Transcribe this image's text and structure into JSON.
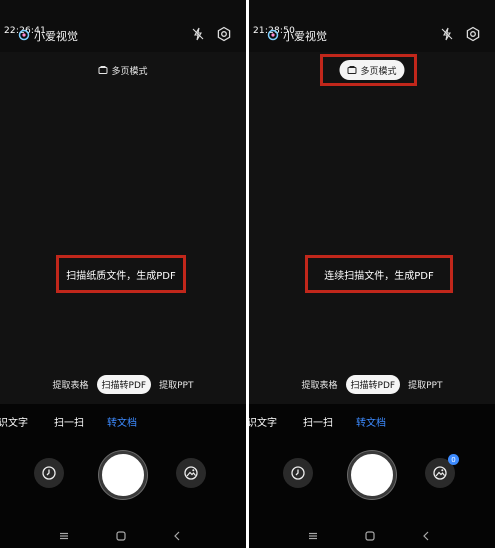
{
  "app": {
    "title": "小爱视觉"
  },
  "left": {
    "time": "22:26:41",
    "multipage_label": "多页模式",
    "hint": "扫描纸质文件，生成PDF",
    "modes": [
      "提取表格",
      "扫描转PDF",
      "提取PPT"
    ],
    "active_mode": "扫描转PDF",
    "tabs": [
      "识文字",
      "扫一扫",
      "转文档"
    ],
    "active_tab": "转文档"
  },
  "right": {
    "time": "21:28:50",
    "multipage_label": "多页模式",
    "multipage_enabled": true,
    "hint": "连续扫描文件，生成PDF",
    "modes": [
      "提取表格",
      "扫描转PDF",
      "提取PPT"
    ],
    "active_mode": "扫描转PDF",
    "tabs": [
      "识文字",
      "扫一扫",
      "转文档"
    ],
    "active_tab": "转文档",
    "gallery_badge": "0"
  },
  "colors": {
    "accent": "#3d8bff",
    "highlight": "#c1271b"
  },
  "icons": [
    "app-logo-icon",
    "flash-off-icon",
    "settings-gear-icon",
    "multipage-icon",
    "history-clock-icon",
    "gallery-icon",
    "nav-menu-icon",
    "nav-home-icon",
    "nav-back-icon"
  ]
}
